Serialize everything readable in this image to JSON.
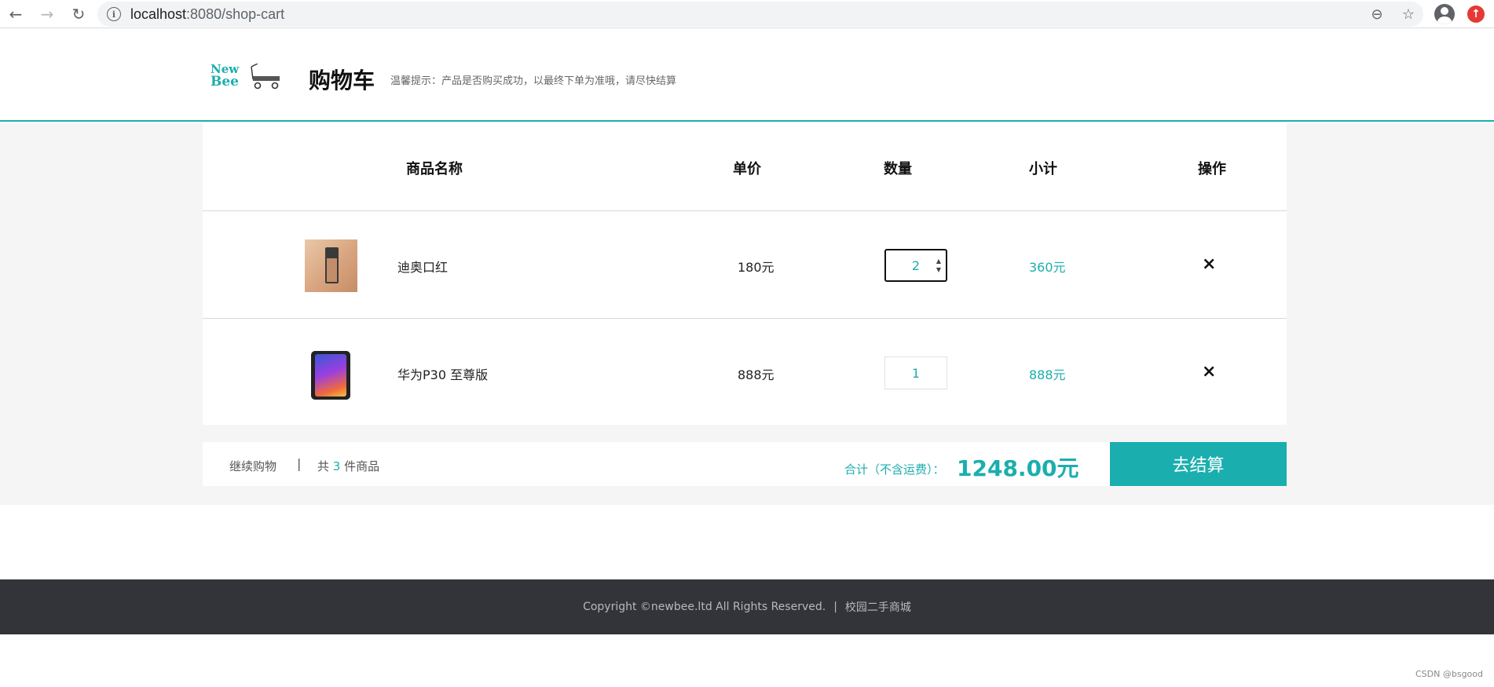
{
  "browser": {
    "url_host": "localhost",
    "url_path": ":8080/shop-cart"
  },
  "header": {
    "logo_line1": "New",
    "logo_line2": "Bee",
    "title": "购物车",
    "tip": "温馨提示：产品是否购买成功，以最终下单为准哦，请尽快结算"
  },
  "table": {
    "columns": [
      "商品名称",
      "单价",
      "数量",
      "小计",
      "操作"
    ],
    "rows": [
      {
        "name": "迪奥口红",
        "price": "180元",
        "quantity": "2",
        "subtotal": "360元",
        "delete": "×"
      },
      {
        "name": "华为P30 至尊版",
        "price": "888元",
        "quantity": "1",
        "subtotal": "888元",
        "delete": "×"
      }
    ]
  },
  "summary": {
    "continue_shopping": "继续购物",
    "separator": "|",
    "count_prefix": "共",
    "count": "3",
    "count_suffix": "件商品",
    "total_label": "合计（不含运费）：",
    "total_amount": "1248.00元",
    "checkout_label": "去结算"
  },
  "footer": {
    "copyright": "Copyright ©newbee.ltd All Rights Reserved.",
    "divider": "|",
    "site_name": "校园二手商城"
  },
  "watermark": "CSDN @bsgood",
  "colors": {
    "accent": "#1baeae",
    "footer_bg": "#33343a"
  }
}
